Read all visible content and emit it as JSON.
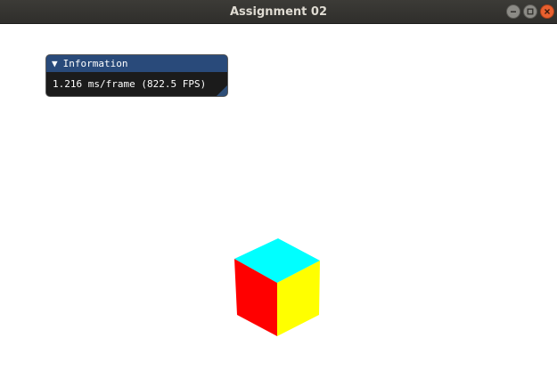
{
  "window": {
    "title": "Assignment 02"
  },
  "titlebar_buttons": {
    "minimize_icon": "minimize-icon",
    "maximize_icon": "maximize-icon",
    "close_icon": "close-icon"
  },
  "info_panel": {
    "arrow": "▼",
    "title": "Information",
    "fps_text": "1.216 ms/frame (822.5 FPS)"
  },
  "cube": {
    "top_color": "#00ffff",
    "left_color": "#ff0000",
    "right_color": "#ffff00"
  },
  "colors": {
    "titlebar_bg": "#3c3b37",
    "title_text": "#dfdbd2",
    "close_button": "#e9602f",
    "panel_header": "#294a7a",
    "panel_body": "#121212"
  }
}
